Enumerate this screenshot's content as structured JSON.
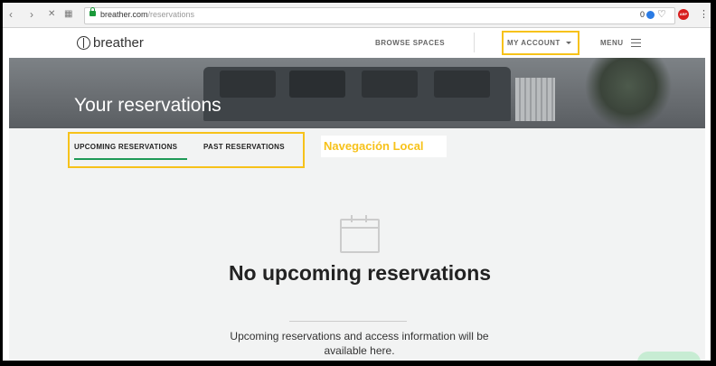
{
  "browser": {
    "url_domain": "breather.com",
    "url_path": "/reservations",
    "nav_back": "‹",
    "nav_forward": "›",
    "nav_close": "✕",
    "nav_apps": "▦",
    "ext_count": "0",
    "ext_heart": "♡",
    "ext_abp": "ABP",
    "ext_menu": "⋮"
  },
  "header": {
    "logo_text": "breather",
    "browse_spaces": "BROWSE SPACES",
    "my_account": "MY ACCOUNT",
    "menu": "MENU",
    "highlight_color": "#f7c21a"
  },
  "hero": {
    "title": "Your reservations"
  },
  "tabs": {
    "upcoming": "UPCOMING RESERVATIONS",
    "past": "PAST RESERVATIONS",
    "active_color": "#1f9a57"
  },
  "annotation": {
    "text": "Navegación Local"
  },
  "empty_state": {
    "icon": "calendar-icon",
    "title": "No upcoming reservations",
    "description": "Upcoming reservations and access information will be available here."
  }
}
